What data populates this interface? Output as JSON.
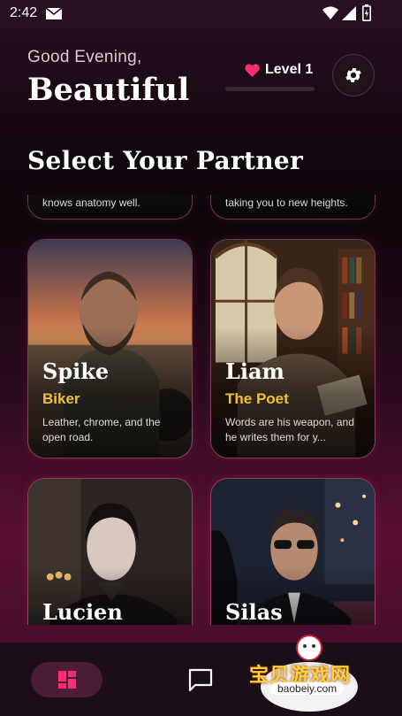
{
  "status_bar": {
    "time": "2:42"
  },
  "header": {
    "greeting": "Good Evening,",
    "name": "Beautiful",
    "level_label": "Level 1",
    "level_progress": 0.0
  },
  "section_title": "Select Your Partner",
  "partners_top_partial": [
    {
      "description": "knows anatomy well."
    },
    {
      "description": "taking you to new heights."
    }
  ],
  "partners": [
    {
      "name": "Spike",
      "role": "Biker",
      "description": "Leather, chrome, and the open road."
    },
    {
      "name": "Liam",
      "role": "The Poet",
      "description": "Words are his weapon, and he writes them for y..."
    },
    {
      "name": "Lucien"
    },
    {
      "name": "Silas"
    }
  ],
  "watermark": {
    "text": "宝贝游戏网",
    "url": "baobeiy.com"
  },
  "colors": {
    "accent_gold": "#f2c12e",
    "heart": "#ff2d6f",
    "nav_active": "#4a1d35"
  }
}
